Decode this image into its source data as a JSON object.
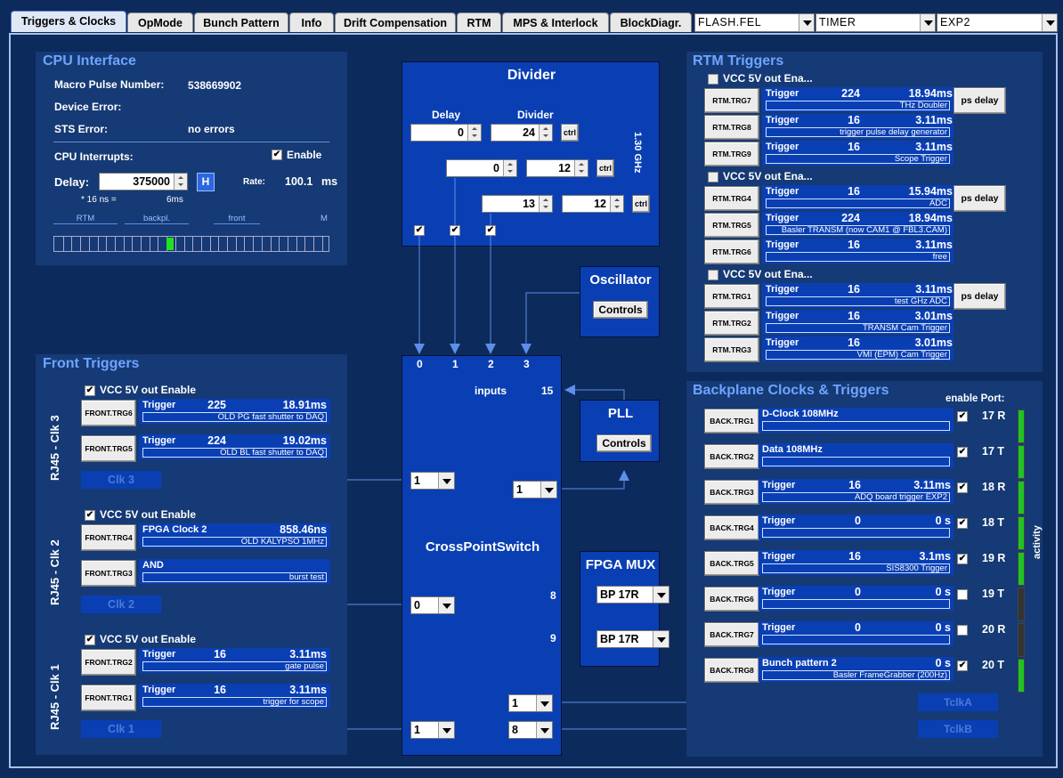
{
  "tabs": [
    "Triggers & Clocks",
    "OpMode",
    "Bunch Pattern",
    "Info",
    "Drift Compensation",
    "RTM",
    "MPS & Interlock",
    "BlockDiagr."
  ],
  "combos": [
    "FLASH.FEL",
    "TIMER",
    "EXP2"
  ],
  "cpu": {
    "title": "CPU Interface",
    "macro_label": "Macro Pulse Number:",
    "macro_value": "538669902",
    "dev_err_label": "Device Error:",
    "dev_err_value": "",
    "sts_label": "STS Error:",
    "sts_value": "no errors",
    "interrupts_label": "CPU Interrupts:",
    "enable_label": "Enable",
    "delay_label": "Delay:",
    "delay_value": "375000",
    "h_label": "H",
    "rate_label": "Rate:",
    "rate_value": "100.1",
    "rate_unit": "ms",
    "ns_note": "* 16 ns =",
    "ns_value": "6ms",
    "scale_labels": [
      "RTM",
      "backpl.",
      "front",
      "M"
    ]
  },
  "divider": {
    "title": "Divider",
    "delay_header": "Delay",
    "divider_header": "Divider",
    "freq": "1.30 GHz",
    "ctrl_label": "ctrl",
    "rows": [
      {
        "delay": "0",
        "div": "24"
      },
      {
        "delay": "0",
        "div": "12"
      },
      {
        "delay": "13",
        "div": "12"
      }
    ]
  },
  "oscillator": {
    "title": "Oscillator",
    "btn": "Controls"
  },
  "pll": {
    "title": "PLL",
    "btn": "Controls"
  },
  "xps": {
    "title": "CrossPointSwitch",
    "inputs_label": "inputs",
    "inputs_num": "15",
    "ports": [
      "0",
      "1",
      "2",
      "3"
    ],
    "in8": "8",
    "in9": "9",
    "sel_left": [
      "1",
      "0",
      "1"
    ],
    "sel_right": [
      "1",
      "1",
      "8"
    ]
  },
  "fpgamux": {
    "title": "FPGA MUX",
    "sel": [
      "BP 17R",
      "BP 17R"
    ]
  },
  "front": {
    "title": "Front Triggers",
    "groups": [
      {
        "side": "RJ45 - Clk 3",
        "vcc": "VCC 5V out Enable",
        "clk": "Clk 3",
        "rows": [
          {
            "btn": "FRONT.TRG6",
            "t": "Trigger",
            "v1": "225",
            "v2": "18.91ms",
            "desc": "OLD PG fast shutter to DAQ"
          },
          {
            "btn": "FRONT.TRG5",
            "t": "Trigger",
            "v1": "224",
            "v2": "19.02ms",
            "desc": "OLD BL fast shutter to DAQ"
          }
        ]
      },
      {
        "side": "RJ45 - Clk 2",
        "vcc": "VCC 5V out Enable",
        "clk": "Clk 2",
        "rows": [
          {
            "btn": "FRONT.TRG4",
            "t": "FPGA Clock 2",
            "v1": "",
            "v2": "858.46ns",
            "desc": "OLD KALYPSO 1MHz"
          },
          {
            "btn": "FRONT.TRG3",
            "t": "AND",
            "v1": "",
            "v2": "",
            "desc": "burst test"
          }
        ]
      },
      {
        "side": "RJ45 - Clk 1",
        "vcc": "VCC 5V out Enable",
        "clk": "Clk 1",
        "rows": [
          {
            "btn": "FRONT.TRG2",
            "t": "Trigger",
            "v1": "16",
            "v2": "3.11ms",
            "desc": "gate pulse"
          },
          {
            "btn": "FRONT.TRG1",
            "t": "Trigger",
            "v1": "16",
            "v2": "3.11ms",
            "desc": "trigger for scope"
          }
        ]
      }
    ]
  },
  "rtm": {
    "title": "RTM Triggers",
    "ps_delay": "ps delay",
    "groups": [
      {
        "vcc": "VCC 5V out Ena...",
        "rows": [
          {
            "btn": "RTM.TRG7",
            "t": "Trigger",
            "v1": "224",
            "v2": "18.94ms",
            "desc": "THz Doubler"
          },
          {
            "btn": "RTM.TRG8",
            "t": "Trigger",
            "v1": "16",
            "v2": "3.11ms",
            "desc": "trigger pulse delay generator"
          },
          {
            "btn": "RTM.TRG9",
            "t": "Trigger",
            "v1": "16",
            "v2": "3.11ms",
            "desc": "Scope Trigger"
          }
        ]
      },
      {
        "vcc": "VCC 5V out Ena...",
        "rows": [
          {
            "btn": "RTM.TRG4",
            "t": "Trigger",
            "v1": "16",
            "v2": "15.94ms",
            "desc": "ADC"
          },
          {
            "btn": "RTM.TRG5",
            "t": "Trigger",
            "v1": "224",
            "v2": "18.94ms",
            "desc": "Basler TRANSM (now CAM1 @ FBL3.CAM)"
          },
          {
            "btn": "RTM.TRG6",
            "t": "Trigger",
            "v1": "16",
            "v2": "3.11ms",
            "desc": "free"
          }
        ]
      },
      {
        "vcc": "VCC 5V out Ena...",
        "rows": [
          {
            "btn": "RTM.TRG1",
            "t": "Trigger",
            "v1": "16",
            "v2": "3.11ms",
            "desc": "test GHz ADC"
          },
          {
            "btn": "RTM.TRG2",
            "t": "Trigger",
            "v1": "16",
            "v2": "3.01ms",
            "desc": "TRANSM Cam Trigger"
          },
          {
            "btn": "RTM.TRG3",
            "t": "Trigger",
            "v1": "16",
            "v2": "3.01ms",
            "desc": "VMI (EPM) Cam Trigger"
          }
        ]
      }
    ]
  },
  "backplane": {
    "title": "Backplane Clocks & Triggers",
    "enable_port": "enable Port:",
    "activity": "activity",
    "tclka": "TclkA",
    "tclkb": "TclkB",
    "rows": [
      {
        "btn": "BACK.TRG1",
        "t": "D-Clock 108MHz",
        "v1": "",
        "v2": "",
        "desc": "",
        "port": "17 R",
        "en": true,
        "act": "#22c322"
      },
      {
        "btn": "BACK.TRG2",
        "t": "Data 108MHz",
        "v1": "",
        "v2": "",
        "desc": "",
        "port": "17 T",
        "en": true,
        "act": "#22c322"
      },
      {
        "btn": "BACK.TRG3",
        "t": "Trigger",
        "v1": "16",
        "v2": "3.11ms",
        "desc": "ADQ board trigger EXP2",
        "port": "18 R",
        "en": true,
        "act": "#22c322"
      },
      {
        "btn": "BACK.TRG4",
        "t": "Trigger",
        "v1": "0",
        "v2": "0 s",
        "desc": "",
        "port": "18 T",
        "en": true,
        "act": "#22c322"
      },
      {
        "btn": "BACK.TRG5",
        "t": "Trigger",
        "v1": "16",
        "v2": "3.1ms",
        "desc": "SIS8300 Trigger",
        "port": "19 R",
        "en": true,
        "act": "#22c322"
      },
      {
        "btn": "BACK.TRG6",
        "t": "Trigger",
        "v1": "0",
        "v2": "0 s",
        "desc": "",
        "port": "19 T",
        "en": false,
        "act": "#333"
      },
      {
        "btn": "BACK.TRG7",
        "t": "Trigger",
        "v1": "0",
        "v2": "0 s",
        "desc": "",
        "port": "20 R",
        "en": false,
        "act": "#333"
      },
      {
        "btn": "BACK.TRG8",
        "t": "Bunch pattern 2",
        "v1": "",
        "v2": "0 s",
        "desc": "Basler FrameGrabber (200Hz)",
        "port": "20 T",
        "en": true,
        "act": "#22c322"
      }
    ]
  }
}
